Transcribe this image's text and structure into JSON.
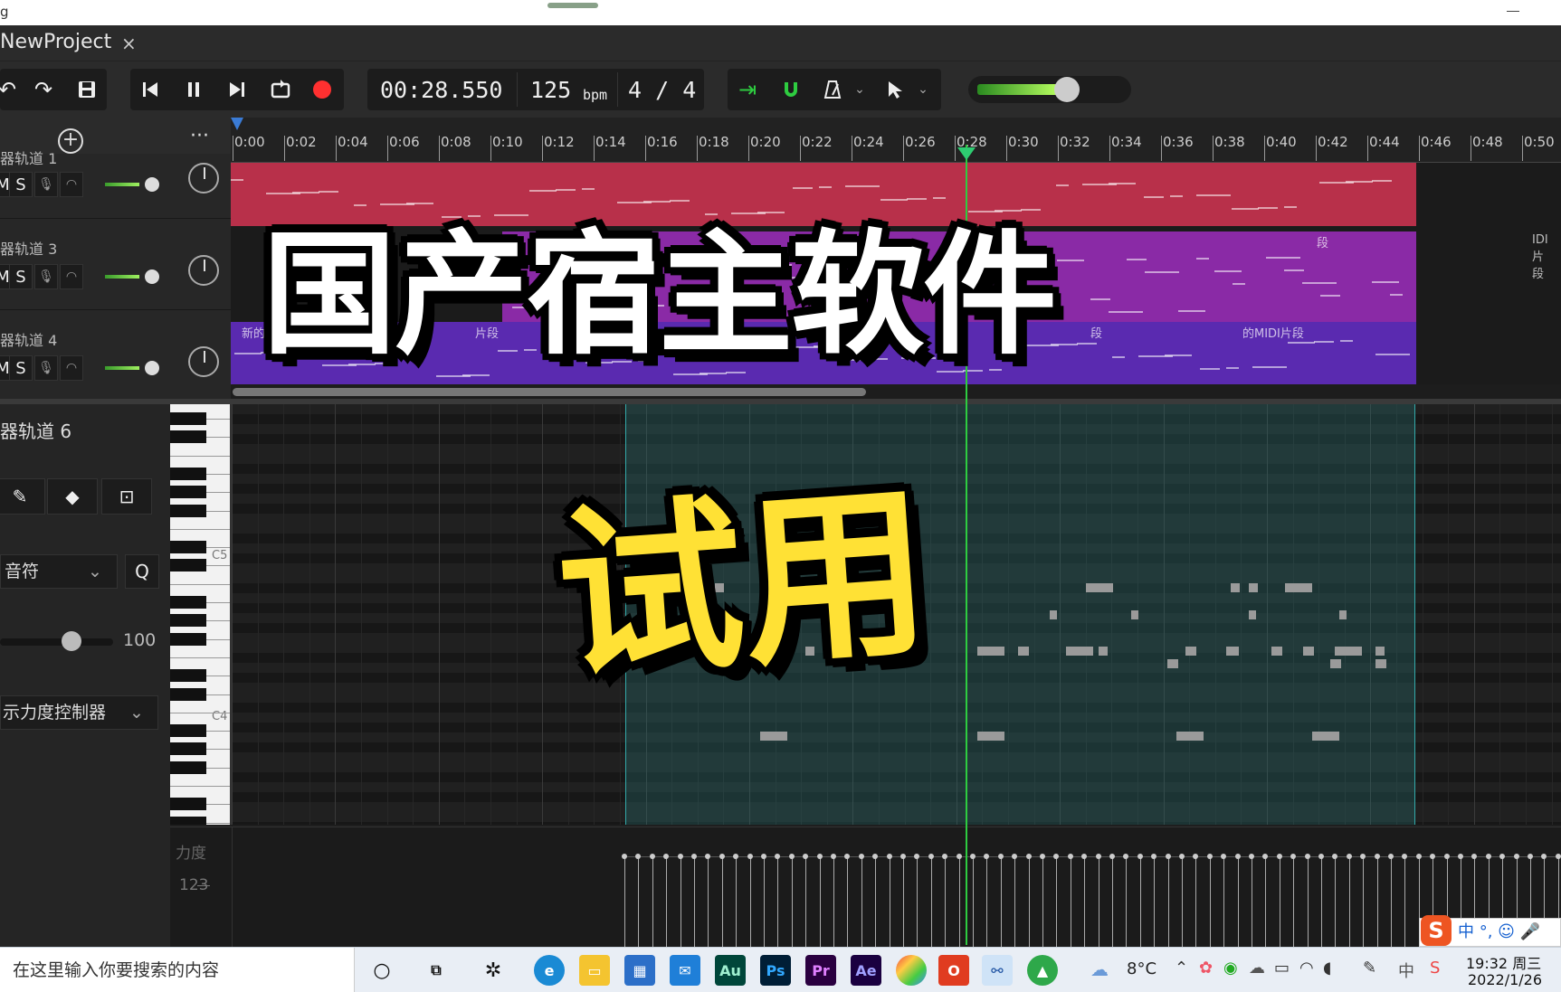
{
  "window": {
    "tab_title": "NewProject",
    "tab_close": "×",
    "title_glyph": "g"
  },
  "toolbar": {
    "time": "00:28.550",
    "tempo": "125",
    "tempo_unit": "bpm",
    "time_signature": "4 / 4",
    "master_volume": 0.62
  },
  "timeline": {
    "ticks": [
      "0:00",
      "0:02",
      "0:04",
      "0:06",
      "0:08",
      "0:10",
      "0:12",
      "0:14",
      "0:16",
      "0:18",
      "0:20",
      "0:22",
      "0:24",
      "0:26",
      "0:28",
      "0:30",
      "0:32",
      "0:34",
      "0:36",
      "0:38",
      "0:40",
      "0:42",
      "0:44",
      "0:46",
      "0:48",
      "0:50"
    ]
  },
  "tracks": [
    {
      "name": "器轨道 1",
      "mute": "M",
      "solo": "S",
      "color": "#b8304a"
    },
    {
      "name": "器轨道 3",
      "mute": "M",
      "solo": "S",
      "color": "#8a2aa6"
    },
    {
      "name": "器轨道 4",
      "mute": "M",
      "solo": "S",
      "color": "#5a2ab0"
    }
  ],
  "clips": {
    "t3_label_a": "段",
    "t3_label_b": "IDI片段",
    "t4_label_a": "新的",
    "t4_label_b": "片段",
    "t4_label_c": "段",
    "t4_label_d": "的MIDI片段"
  },
  "piano_roll": {
    "track_name": "器轨道 6",
    "note_mode": "音符",
    "quantize": "Q",
    "velocity_value": "100",
    "velocity_fraction": 0.55,
    "controller": "示力度控制器",
    "key_c5": "C5",
    "key_c4": "C4"
  },
  "velocity_lane": {
    "label": "力度",
    "value": "123"
  },
  "overlay": {
    "main": "国产宿主软件",
    "sub": "试用"
  },
  "taskbar": {
    "search_placeholder": "在这里输入你要搜索的内容",
    "weather": "8°C",
    "time": "19:32 周三",
    "date": "2022/1/26",
    "ime": "中 °, ☺ 🎤 ▦",
    "ime_logo": "S",
    "apps": [
      "Au",
      "Ps",
      "Pr",
      "Ae"
    ]
  },
  "colors": {
    "accent_green": "#2ecc40",
    "record_red": "#ff3030",
    "sel_teal": "#2a7878"
  }
}
